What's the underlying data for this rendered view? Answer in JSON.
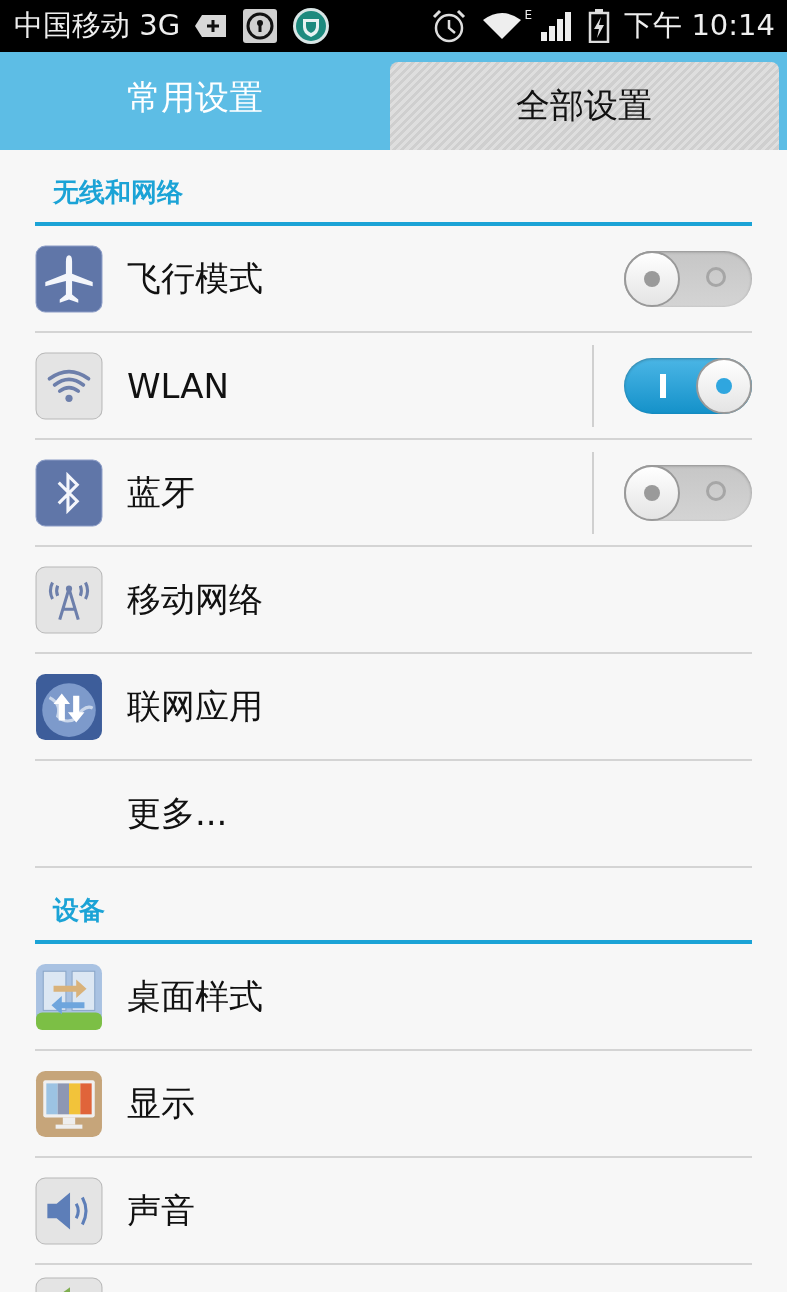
{
  "status_bar": {
    "carrier": "中国移动 3G",
    "network_type": "E",
    "time": "下午 10:14"
  },
  "tabs": [
    {
      "label": "常用设置",
      "selected": false
    },
    {
      "label": "全部设置",
      "selected": true
    }
  ],
  "sections": [
    {
      "title": "无线和网络",
      "items": [
        {
          "kind": "toggle",
          "label": "飞行模式",
          "on": false
        },
        {
          "kind": "split-toggle",
          "label": "WLAN",
          "on": true
        },
        {
          "kind": "split-toggle",
          "label": "蓝牙",
          "on": false
        },
        {
          "kind": "link",
          "label": "移动网络"
        },
        {
          "kind": "link",
          "label": "联网应用"
        },
        {
          "kind": "text",
          "label": "更多..."
        }
      ]
    },
    {
      "title": "设备",
      "items": [
        {
          "kind": "link",
          "label": "桌面样式"
        },
        {
          "kind": "link",
          "label": "显示"
        },
        {
          "kind": "link",
          "label": "声音"
        },
        {
          "kind": "partial"
        }
      ]
    }
  ]
}
